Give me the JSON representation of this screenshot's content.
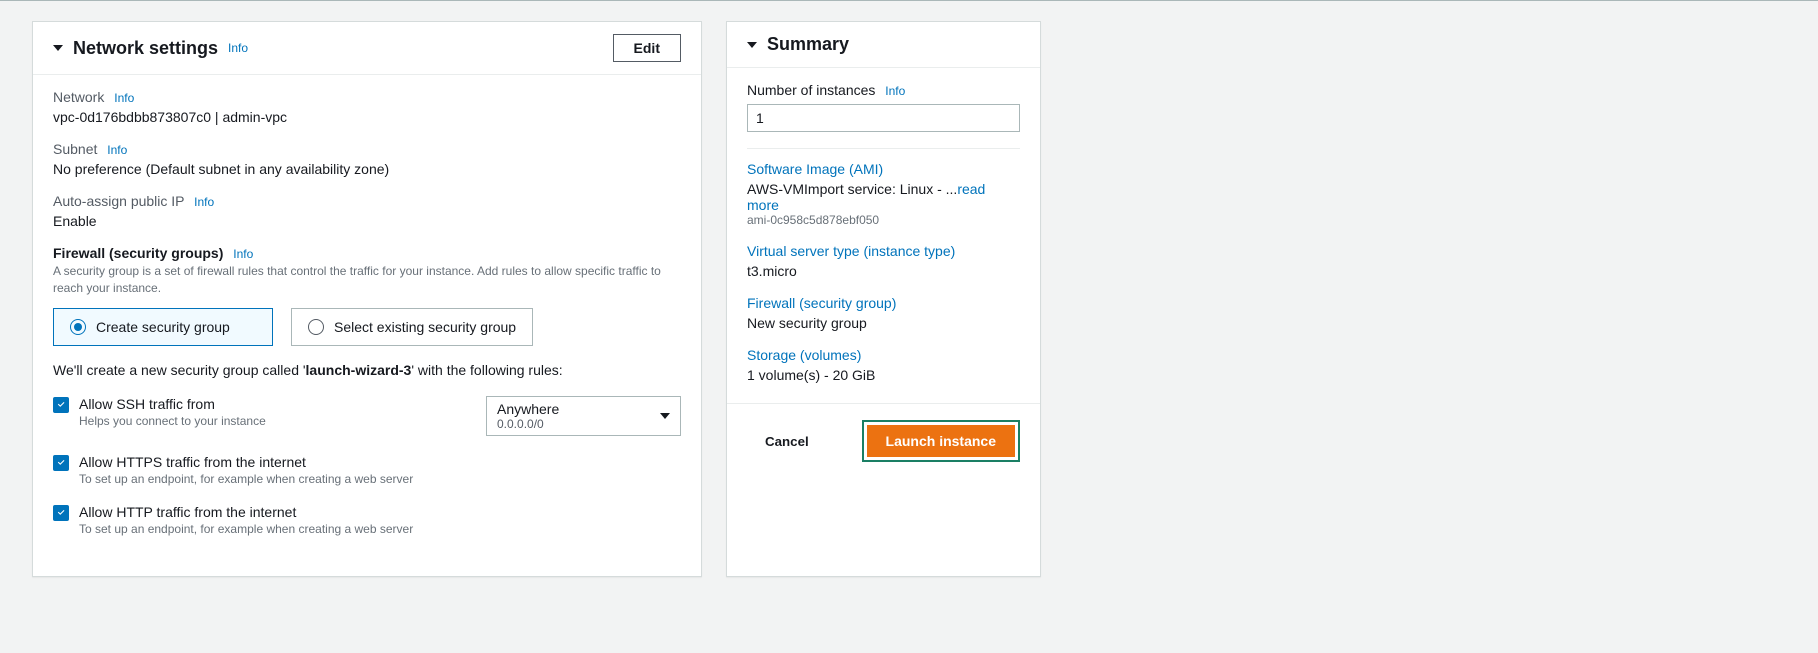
{
  "network": {
    "title": "Network settings",
    "info": "Info",
    "edit_label": "Edit",
    "vpc": {
      "label": "Network",
      "value": "vpc-0d176bdbb873807c0 | admin-vpc"
    },
    "subnet": {
      "label": "Subnet",
      "value": "No preference (Default subnet in any availability zone)"
    },
    "public_ip": {
      "label": "Auto-assign public IP",
      "value": "Enable"
    },
    "firewall": {
      "label": "Firewall (security groups)",
      "helper": "A security group is a set of firewall rules that control the traffic for your instance. Add rules to allow specific traffic to reach your instance.",
      "create_label": "Create security group",
      "existing_label": "Select existing security group",
      "sentence_pre": "We'll create a new security group called '",
      "sg_name": "launch-wizard-3",
      "sentence_post": "' with the following rules:"
    },
    "rules": {
      "ssh": {
        "title": "Allow SSH traffic from",
        "helper": "Helps you connect to your instance",
        "select": {
          "label": "Anywhere",
          "sub": "0.0.0.0/0"
        }
      },
      "https": {
        "title": "Allow HTTPS traffic from the internet",
        "helper": "To set up an endpoint, for example when creating a web server"
      },
      "http": {
        "title": "Allow HTTP traffic from the internet",
        "helper": "To set up an endpoint, for example when creating a web server"
      }
    }
  },
  "summary": {
    "title": "Summary",
    "num_instances": {
      "label": "Number of instances",
      "info": "Info",
      "value": "1"
    },
    "ami": {
      "link": "Software Image (AMI)",
      "value_pre": "AWS-VMImport service: Linux - ...",
      "readmore": "read more",
      "id": "ami-0c958c5d878ebf050"
    },
    "instance_type": {
      "link": "Virtual server type (instance type)",
      "value": "t3.micro"
    },
    "firewall": {
      "link": "Firewall (security group)",
      "value": "New security group"
    },
    "storage": {
      "link": "Storage (volumes)",
      "value": "1 volume(s) - 20 GiB"
    },
    "cancel": "Cancel",
    "launch": "Launch instance"
  }
}
